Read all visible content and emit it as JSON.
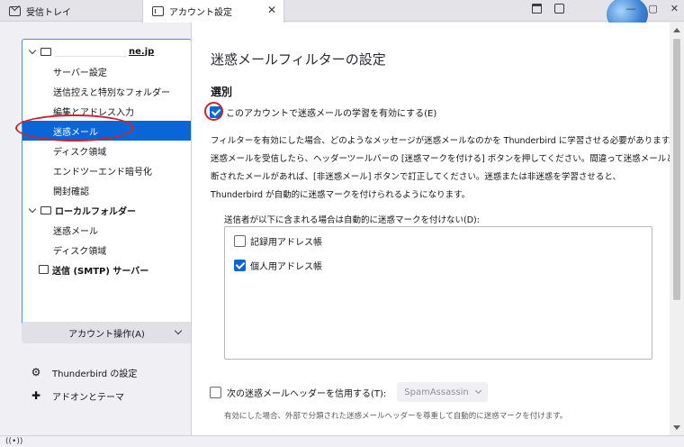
{
  "tabs": [
    {
      "label": "受信トレイ",
      "icon": "mail-icon"
    },
    {
      "label": "アカウント設定",
      "icon": "account-settings-icon",
      "close": "✕"
    }
  ],
  "window_controls": {
    "minimize": "—",
    "maximize": "▢",
    "close": "✕"
  },
  "sidebar": {
    "account": {
      "email_visible": "ne.jp"
    },
    "account_items": [
      "サーバー設定",
      "送信控えと特別なフォルダー",
      "編集とアドレス入力",
      "迷惑メール",
      "ディスク領域",
      "エンドツーエンド暗号化",
      "開封確認"
    ],
    "selected_item": "迷惑メール",
    "local_folders": {
      "label": "ローカルフォルダー",
      "items": [
        "迷惑メール",
        "ディスク領域"
      ]
    },
    "smtp": "送信 (SMTP) サーバー",
    "account_actions": "アカウント操作(A)",
    "links": [
      {
        "label": "Thunderbird の設定",
        "icon": "gear-icon"
      },
      {
        "label": "アドオンとテーマ",
        "icon": "puzzle-icon"
      }
    ]
  },
  "main": {
    "title": "迷惑メールフィルターの設定",
    "section": "選別",
    "enable_label": "このアカウントで迷惑メールの学習を有効にする(E)",
    "enable_checked": true,
    "description": [
      "フィルターを有効にした場合、どのようなメッセージが迷惑メールなのかを Thunderbird に学習させる必要があります。",
      "迷惑メールを受信したら、ヘッダーツールバーの [迷惑マークを付ける] ボタンを押してください。間違って迷惑メールと判",
      "断されたメールがあれば、[非迷惑メール] ボタンで訂正してください。迷惑または非迷惑を学習させると、",
      "Thunderbird が自動的に迷惑マークを付けられるようになります。"
    ],
    "whitelist_label": "送信者が以下に含まれる場合は自動的に迷惑マークを付けない(D):",
    "address_books": [
      {
        "label": "記録用アドレス帳",
        "checked": false
      },
      {
        "label": "個人用アドレス帳",
        "checked": true
      }
    ],
    "trust_header_label": "次の迷惑メールヘッダーを信用する(T):",
    "trust_header_checked": false,
    "trust_header_select": "SpamAssassin",
    "trust_header_note": "有効にした場合、外部で分類された迷惑メールヘッダーを尊重して自動的に迷惑マークを付けます。"
  },
  "status_icon": "activity-icon",
  "colors": {
    "accent": "#0a66d6",
    "annotation": "#c8252b"
  }
}
